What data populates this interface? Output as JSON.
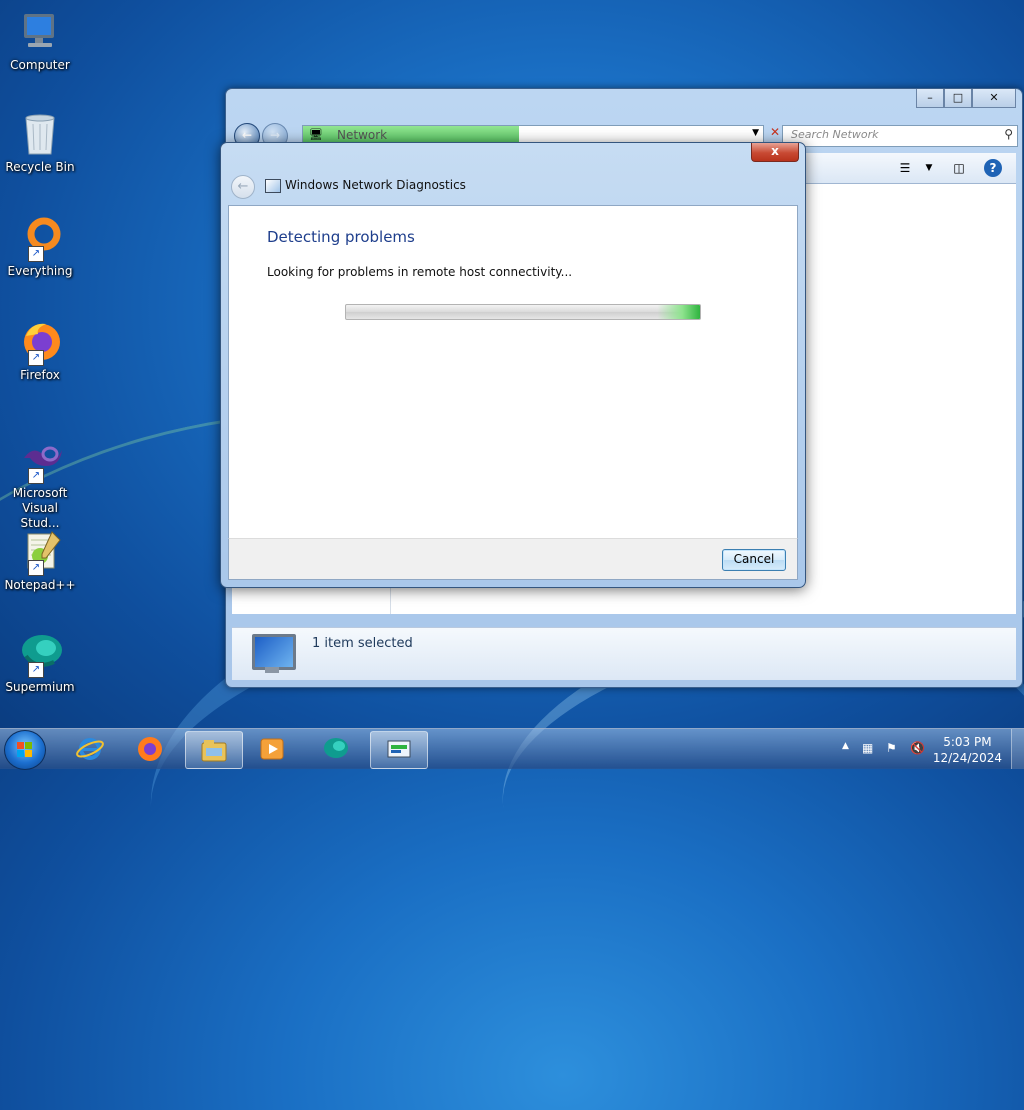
{
  "desktop": {
    "icons": [
      {
        "label": "Computer",
        "icon": "computer-icon"
      },
      {
        "label": "Recycle Bin",
        "icon": "recycle-bin-icon"
      },
      {
        "label": "Everything",
        "icon": "everything-icon"
      },
      {
        "label": "Firefox",
        "icon": "firefox-icon"
      },
      {
        "label": "Microsoft Visual Stud...",
        "icon": "visual-studio-icon"
      },
      {
        "label": "Notepad++",
        "icon": "notepad-plus-plus-icon"
      },
      {
        "label": "Supermium",
        "icon": "supermium-icon"
      }
    ]
  },
  "explorer": {
    "address": "Network",
    "address_progress": 0.47,
    "search_placeholder": "Search Network",
    "status_text": "1 item selected"
  },
  "dialog": {
    "title": "Windows Network Diagnostics",
    "heading": "Detecting problems",
    "message": "Looking for problems in remote host connectivity...",
    "progress": 1.0,
    "cancel_label": "Cancel",
    "close_glyph": "x"
  },
  "taskbar": {
    "items": [
      "internet-explorer-icon",
      "firefox-icon",
      "windows-explorer-icon",
      "media-player-icon",
      "supermium-icon",
      "network-diagnostics-icon"
    ],
    "active_item": "network-diagnostics-icon",
    "time": "5:03 PM",
    "date": "12/24/2024"
  },
  "colors": {
    "heading": "#1e3e8c",
    "progress_green": "#2fb43f",
    "close_red": "#c84a33"
  }
}
